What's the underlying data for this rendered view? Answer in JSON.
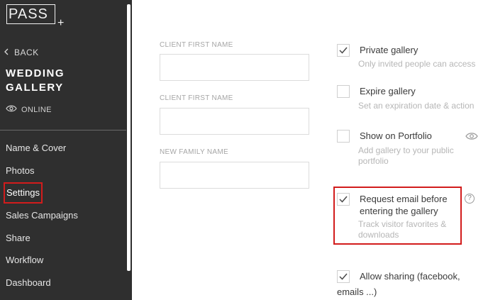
{
  "logo": {
    "text": "PASS",
    "plus": "+"
  },
  "sidebar": {
    "back_label": "BACK",
    "gallery_title": "WEDDING GALLERY",
    "status": "ONLINE",
    "nav": [
      {
        "label": "Name & Cover"
      },
      {
        "label": "Photos"
      },
      {
        "label": "Settings",
        "active": true
      },
      {
        "label": "Sales Campaigns"
      },
      {
        "label": "Share"
      },
      {
        "label": "Workflow"
      },
      {
        "label": "Dashboard"
      }
    ]
  },
  "form": {
    "fields": [
      {
        "label": "CLIENT FIRST NAME",
        "value": ""
      },
      {
        "label": "CLIENT FIRST NAME",
        "value": ""
      },
      {
        "label": "NEW FAMILY NAME",
        "value": ""
      }
    ]
  },
  "options": [
    {
      "title": "Private gallery",
      "desc": "Only invited people can access",
      "checked": true
    },
    {
      "title": "Expire gallery",
      "desc": "Set an expiration date & action",
      "checked": false
    },
    {
      "title": "Show on Portfolio",
      "desc": "Add gallery to your public portfolio",
      "checked": false
    },
    {
      "title": "Request email before entering the gallery",
      "desc": "Track visitor favorites & downloads",
      "checked": true
    },
    {
      "title": "Allow sharing (facebook, emails ...)",
      "desc": "",
      "checked": true
    }
  ],
  "colors": {
    "sidebar_bg": "#2f2f2f",
    "highlight": "#d21c1c"
  },
  "icons": {
    "back": "chevron-left-icon",
    "online": "eye-icon",
    "help": "question-icon",
    "check": "checkmark-icon"
  },
  "help_symbol": "?"
}
